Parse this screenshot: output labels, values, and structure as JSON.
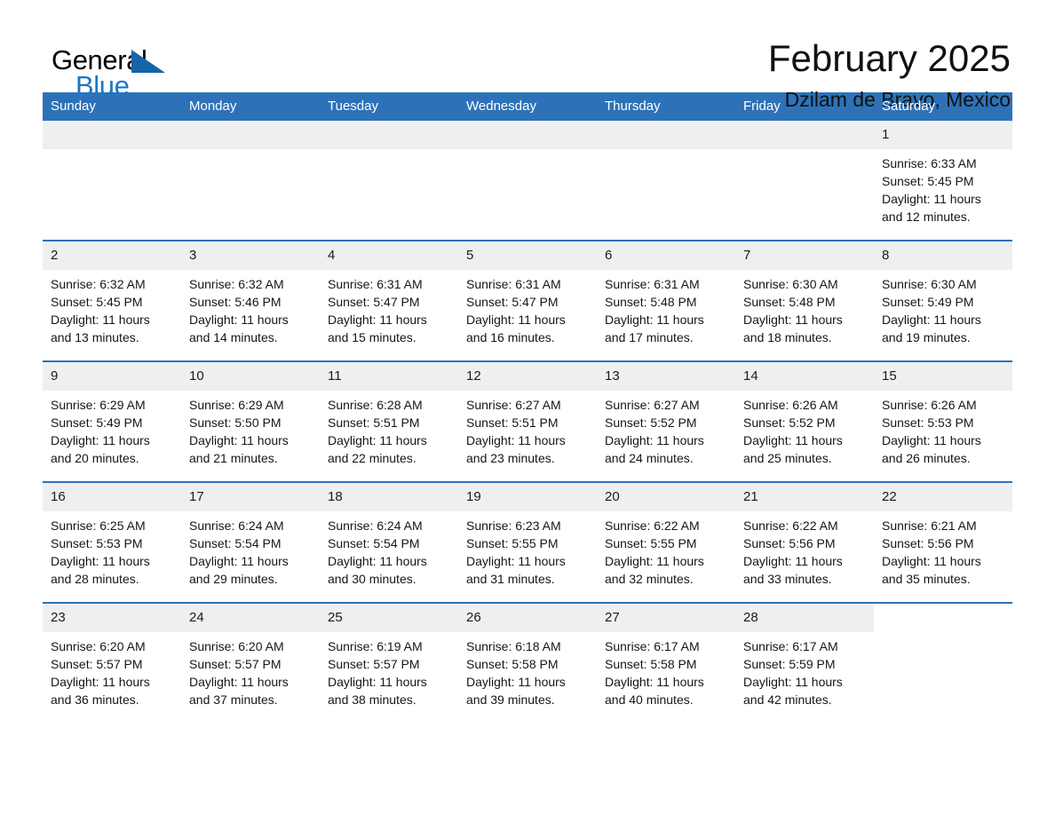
{
  "logo": {
    "word_one": "General",
    "word_two": "Blue",
    "triangle_icon": "triangle-icon",
    "colors": {
      "black": "#000000",
      "blue": "#1a76c4",
      "triangle": "#1565a8"
    }
  },
  "header": {
    "title": "February 2025",
    "subtitle": "Dzilam de Bravo, Mexico"
  },
  "theme": {
    "header_blue": "#2d72b8",
    "daynum_band": "#efefef",
    "row_rule": "#2d72b8",
    "text": "#161616"
  },
  "calendar": {
    "weekday_headers": [
      "Sunday",
      "Monday",
      "Tuesday",
      "Wednesday",
      "Thursday",
      "Friday",
      "Saturday"
    ],
    "weeks": [
      [
        {
          "blank": true
        },
        {
          "blank": true
        },
        {
          "blank": true
        },
        {
          "blank": true
        },
        {
          "blank": true
        },
        {
          "blank": true
        },
        {
          "day": "1",
          "sunrise": "Sunrise: 6:33 AM",
          "sunset": "Sunset: 5:45 PM",
          "daylight": "Daylight: 11 hours and 12 minutes."
        }
      ],
      [
        {
          "day": "2",
          "sunrise": "Sunrise: 6:32 AM",
          "sunset": "Sunset: 5:45 PM",
          "daylight": "Daylight: 11 hours and 13 minutes."
        },
        {
          "day": "3",
          "sunrise": "Sunrise: 6:32 AM",
          "sunset": "Sunset: 5:46 PM",
          "daylight": "Daylight: 11 hours and 14 minutes."
        },
        {
          "day": "4",
          "sunrise": "Sunrise: 6:31 AM",
          "sunset": "Sunset: 5:47 PM",
          "daylight": "Daylight: 11 hours and 15 minutes."
        },
        {
          "day": "5",
          "sunrise": "Sunrise: 6:31 AM",
          "sunset": "Sunset: 5:47 PM",
          "daylight": "Daylight: 11 hours and 16 minutes."
        },
        {
          "day": "6",
          "sunrise": "Sunrise: 6:31 AM",
          "sunset": "Sunset: 5:48 PM",
          "daylight": "Daylight: 11 hours and 17 minutes."
        },
        {
          "day": "7",
          "sunrise": "Sunrise: 6:30 AM",
          "sunset": "Sunset: 5:48 PM",
          "daylight": "Daylight: 11 hours and 18 minutes."
        },
        {
          "day": "8",
          "sunrise": "Sunrise: 6:30 AM",
          "sunset": "Sunset: 5:49 PM",
          "daylight": "Daylight: 11 hours and 19 minutes."
        }
      ],
      [
        {
          "day": "9",
          "sunrise": "Sunrise: 6:29 AM",
          "sunset": "Sunset: 5:49 PM",
          "daylight": "Daylight: 11 hours and 20 minutes."
        },
        {
          "day": "10",
          "sunrise": "Sunrise: 6:29 AM",
          "sunset": "Sunset: 5:50 PM",
          "daylight": "Daylight: 11 hours and 21 minutes."
        },
        {
          "day": "11",
          "sunrise": "Sunrise: 6:28 AM",
          "sunset": "Sunset: 5:51 PM",
          "daylight": "Daylight: 11 hours and 22 minutes."
        },
        {
          "day": "12",
          "sunrise": "Sunrise: 6:27 AM",
          "sunset": "Sunset: 5:51 PM",
          "daylight": "Daylight: 11 hours and 23 minutes."
        },
        {
          "day": "13",
          "sunrise": "Sunrise: 6:27 AM",
          "sunset": "Sunset: 5:52 PM",
          "daylight": "Daylight: 11 hours and 24 minutes."
        },
        {
          "day": "14",
          "sunrise": "Sunrise: 6:26 AM",
          "sunset": "Sunset: 5:52 PM",
          "daylight": "Daylight: 11 hours and 25 minutes."
        },
        {
          "day": "15",
          "sunrise": "Sunrise: 6:26 AM",
          "sunset": "Sunset: 5:53 PM",
          "daylight": "Daylight: 11 hours and 26 minutes."
        }
      ],
      [
        {
          "day": "16",
          "sunrise": "Sunrise: 6:25 AM",
          "sunset": "Sunset: 5:53 PM",
          "daylight": "Daylight: 11 hours and 28 minutes."
        },
        {
          "day": "17",
          "sunrise": "Sunrise: 6:24 AM",
          "sunset": "Sunset: 5:54 PM",
          "daylight": "Daylight: 11 hours and 29 minutes."
        },
        {
          "day": "18",
          "sunrise": "Sunrise: 6:24 AM",
          "sunset": "Sunset: 5:54 PM",
          "daylight": "Daylight: 11 hours and 30 minutes."
        },
        {
          "day": "19",
          "sunrise": "Sunrise: 6:23 AM",
          "sunset": "Sunset: 5:55 PM",
          "daylight": "Daylight: 11 hours and 31 minutes."
        },
        {
          "day": "20",
          "sunrise": "Sunrise: 6:22 AM",
          "sunset": "Sunset: 5:55 PM",
          "daylight": "Daylight: 11 hours and 32 minutes."
        },
        {
          "day": "21",
          "sunrise": "Sunrise: 6:22 AM",
          "sunset": "Sunset: 5:56 PM",
          "daylight": "Daylight: 11 hours and 33 minutes."
        },
        {
          "day": "22",
          "sunrise": "Sunrise: 6:21 AM",
          "sunset": "Sunset: 5:56 PM",
          "daylight": "Daylight: 11 hours and 35 minutes."
        }
      ],
      [
        {
          "day": "23",
          "sunrise": "Sunrise: 6:20 AM",
          "sunset": "Sunset: 5:57 PM",
          "daylight": "Daylight: 11 hours and 36 minutes."
        },
        {
          "day": "24",
          "sunrise": "Sunrise: 6:20 AM",
          "sunset": "Sunset: 5:57 PM",
          "daylight": "Daylight: 11 hours and 37 minutes."
        },
        {
          "day": "25",
          "sunrise": "Sunrise: 6:19 AM",
          "sunset": "Sunset: 5:57 PM",
          "daylight": "Daylight: 11 hours and 38 minutes."
        },
        {
          "day": "26",
          "sunrise": "Sunrise: 6:18 AM",
          "sunset": "Sunset: 5:58 PM",
          "daylight": "Daylight: 11 hours and 39 minutes."
        },
        {
          "day": "27",
          "sunrise": "Sunrise: 6:17 AM",
          "sunset": "Sunset: 5:58 PM",
          "daylight": "Daylight: 11 hours and 40 minutes."
        },
        {
          "day": "28",
          "sunrise": "Sunrise: 6:17 AM",
          "sunset": "Sunset: 5:59 PM",
          "daylight": "Daylight: 11 hours and 42 minutes."
        },
        {
          "nodate": true
        }
      ]
    ]
  }
}
